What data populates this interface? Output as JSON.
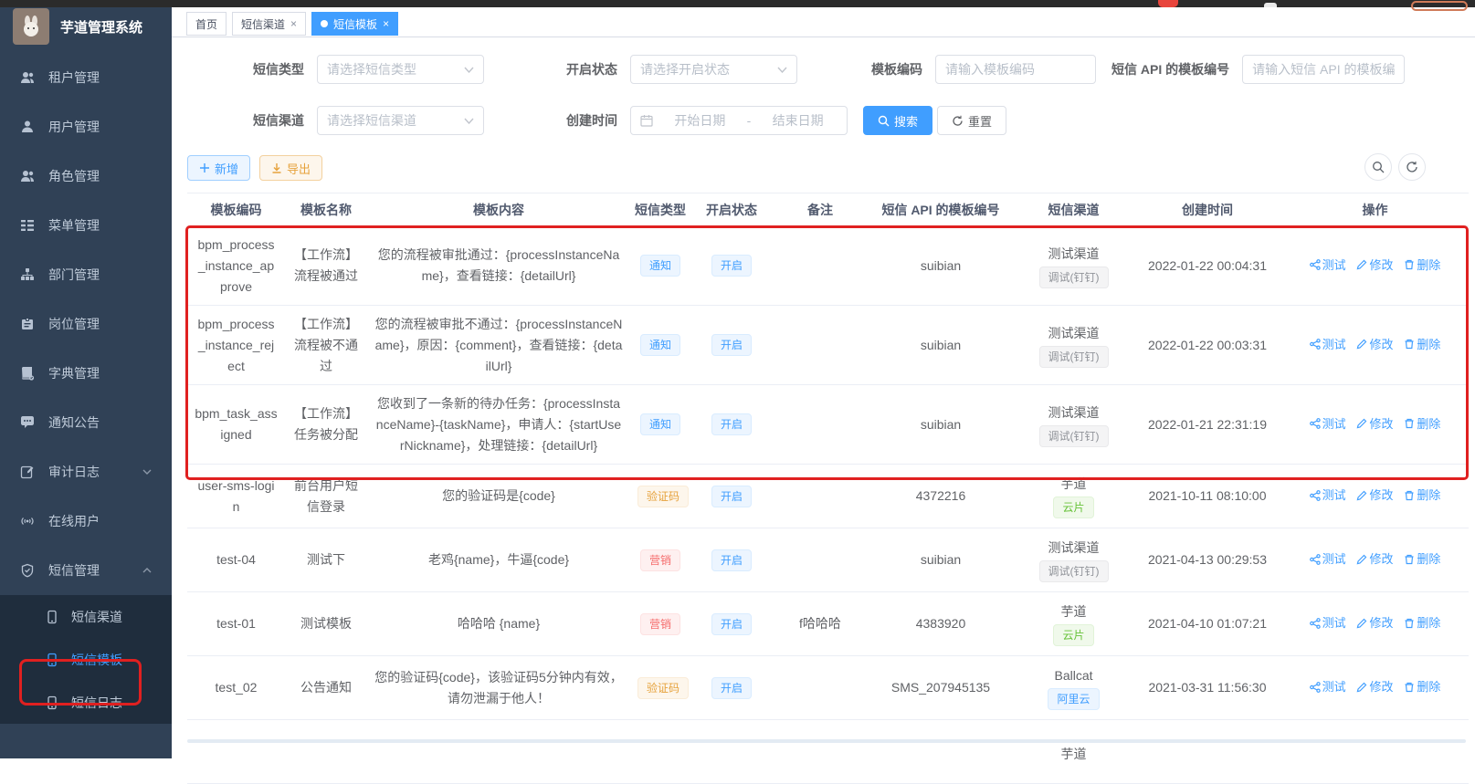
{
  "app": {
    "title": "芋道管理系统"
  },
  "colors": {
    "primary": "#409eff",
    "sidebar_bg": "#304156",
    "submenu_bg": "#1f2d3d",
    "annotation_red": "#e02020",
    "tag_success": "#67c23a",
    "tag_warning": "#e6a23c",
    "tag_danger": "#f56c6c",
    "tag_info": "#909399"
  },
  "icons": {
    "search": "magnifier",
    "refresh": "circular-arrows",
    "add": "plus",
    "export": "download-arrow",
    "calendar": "calendar",
    "test": "share",
    "edit": "pen",
    "delete": "trash"
  },
  "sidebar": {
    "items": [
      {
        "label": "租户管理"
      },
      {
        "label": "用户管理"
      },
      {
        "label": "角色管理"
      },
      {
        "label": "菜单管理"
      },
      {
        "label": "部门管理"
      },
      {
        "label": "岗位管理"
      },
      {
        "label": "字典管理"
      },
      {
        "label": "通知公告"
      },
      {
        "label": "审计日志"
      },
      {
        "label": "在线用户"
      },
      {
        "label": "短信管理"
      }
    ],
    "submenu": [
      {
        "label": "短信渠道"
      },
      {
        "label": "短信模板"
      },
      {
        "label": "短信日志"
      }
    ]
  },
  "tabs": [
    {
      "label": "首页"
    },
    {
      "label": "短信渠道"
    },
    {
      "label": "短信模板"
    }
  ],
  "search": {
    "sms_type_label": "短信类型",
    "sms_type_placeholder": "请选择短信类型",
    "status_label": "开启状态",
    "status_placeholder": "请选择开启状态",
    "code_label": "模板编码",
    "code_placeholder": "请输入模板编码",
    "api_label": "短信 API 的模板编号",
    "api_placeholder": "请输入短信 API 的模板编号",
    "channel_label": "短信渠道",
    "channel_placeholder": "请选择短信渠道",
    "time_label": "创建时间",
    "date_start_placeholder": "开始日期",
    "date_separator": "-",
    "date_end_placeholder": "结束日期",
    "search_button": "搜索",
    "reset_button": "重置"
  },
  "toolbar": {
    "add_label": "新增",
    "export_label": "导出"
  },
  "table": {
    "headers": [
      "模板编码",
      "模板名称",
      "模板内容",
      "短信类型",
      "开启状态",
      "备注",
      "短信 API 的模板编号",
      "短信渠道",
      "创建时间",
      "操作"
    ],
    "actions": {
      "test": "测试",
      "edit": "修改",
      "delete": "删除"
    },
    "rows": [
      {
        "code": "bpm_process_instance_approve",
        "name": "【工作流】流程被通过",
        "content": "您的流程被审批通过：{processInstanceName}，查看链接：{detailUrl}",
        "type": "通知",
        "type_variant": "primary",
        "status": "开启",
        "remark": "",
        "api_id": "suibian",
        "channel_name": "测试渠道",
        "channel_tag": "调试(钉钉)",
        "channel_tag_variant": "info",
        "created": "2022-01-22 00:04:31"
      },
      {
        "code": "bpm_process_instance_reject",
        "name": "【工作流】流程被不通过",
        "content": "您的流程被审批不通过：{processInstanceName}，原因：{comment}，查看链接：{detailUrl}",
        "type": "通知",
        "type_variant": "primary",
        "status": "开启",
        "remark": "",
        "api_id": "suibian",
        "channel_name": "测试渠道",
        "channel_tag": "调试(钉钉)",
        "channel_tag_variant": "info",
        "created": "2022-01-22 00:03:31"
      },
      {
        "code": "bpm_task_assigned",
        "name": "【工作流】任务被分配",
        "content": "您收到了一条新的待办任务：{processInstanceName}-{taskName}，申请人：{startUserNickname}，处理链接：{detailUrl}",
        "type": "通知",
        "type_variant": "primary",
        "status": "开启",
        "remark": "",
        "api_id": "suibian",
        "channel_name": "测试渠道",
        "channel_tag": "调试(钉钉)",
        "channel_tag_variant": "info",
        "created": "2022-01-21 22:31:19"
      },
      {
        "code": "user-sms-login",
        "name": "前台用户短信登录",
        "content": "您的验证码是{code}",
        "type": "验证码",
        "type_variant": "warning",
        "status": "开启",
        "remark": "",
        "api_id": "4372216",
        "channel_name": "芋道",
        "channel_tag": "云片",
        "channel_tag_variant": "success",
        "created": "2021-10-11 08:10:00"
      },
      {
        "code": "test-04",
        "name": "测试下",
        "content": "老鸡{name}，牛逼{code}",
        "type": "营销",
        "type_variant": "danger",
        "status": "开启",
        "remark": "",
        "api_id": "suibian",
        "channel_name": "测试渠道",
        "channel_tag": "调试(钉钉)",
        "channel_tag_variant": "info",
        "created": "2021-04-13 00:29:53"
      },
      {
        "code": "test-01",
        "name": "测试模板",
        "content": "哈哈哈 {name}",
        "type": "营销",
        "type_variant": "danger",
        "status": "开启",
        "remark": "f哈哈哈",
        "api_id": "4383920",
        "channel_name": "芋道",
        "channel_tag": "云片",
        "channel_tag_variant": "success",
        "created": "2021-04-10 01:07:21"
      },
      {
        "code": "test_02",
        "name": "公告通知",
        "content": "您的验证码{code}，该验证码5分钟内有效，请勿泄漏于他人！",
        "type": "验证码",
        "type_variant": "warning",
        "status": "开启",
        "remark": "",
        "api_id": "SMS_207945135",
        "channel_name": "Ballcat",
        "channel_tag": "阿里云",
        "channel_tag_variant": "primary",
        "created": "2021-03-31 11:56:30"
      }
    ],
    "partial_row": {
      "channel_name": "芋道"
    }
  }
}
